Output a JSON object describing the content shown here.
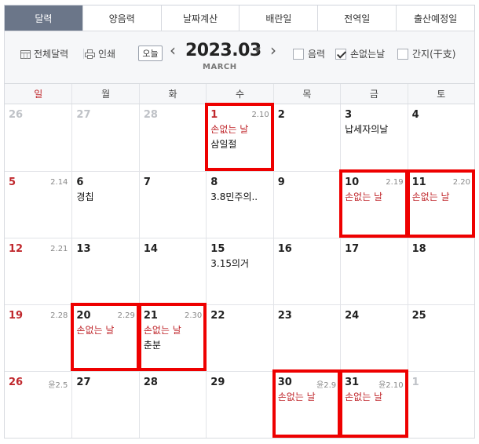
{
  "tabs": [
    {
      "label": "달력",
      "active": true
    },
    {
      "label": "양음력",
      "active": false
    },
    {
      "label": "날짜계산",
      "active": false
    },
    {
      "label": "배란일",
      "active": false
    },
    {
      "label": "전역일",
      "active": false
    },
    {
      "label": "출산예정일",
      "active": false
    }
  ],
  "toolbar": {
    "full_calendar": "전체달력",
    "print": "인쇄",
    "today": "오늘",
    "prev": "‹",
    "next": "›",
    "month": "2023.03",
    "caret": "▼",
    "month_en": "MARCH",
    "lunar_label": "음력",
    "lunar_checked": false,
    "sonless_label": "손없는날",
    "sonless_checked": true,
    "ganji_label": "간지(干支)",
    "ganji_checked": false
  },
  "weekdays": [
    "일",
    "월",
    "화",
    "수",
    "목",
    "금",
    "토"
  ],
  "colors": {
    "holiday_red": "#c0282d",
    "highlight": "#ee0000",
    "tab_active": "#6b7689"
  },
  "weeks": [
    [
      {
        "day": "26",
        "other": true
      },
      {
        "day": "27",
        "other": true
      },
      {
        "day": "28",
        "other": true
      },
      {
        "day": "1",
        "red_day": true,
        "lunar": "2.10",
        "events": [
          {
            "text": "손없는 날",
            "red": true
          },
          {
            "text": "삼일절",
            "red": false
          }
        ],
        "highlight": true
      },
      {
        "day": "2"
      },
      {
        "day": "3",
        "events": [
          {
            "text": "납세자의날",
            "red": false
          }
        ]
      },
      {
        "day": "4"
      }
    ],
    [
      {
        "day": "5",
        "lunar": "2.14"
      },
      {
        "day": "6",
        "events": [
          {
            "text": "경칩",
            "red": false
          }
        ]
      },
      {
        "day": "7"
      },
      {
        "day": "8",
        "events": [
          {
            "text": "3.8민주의..",
            "red": false
          }
        ]
      },
      {
        "day": "9"
      },
      {
        "day": "10",
        "lunar": "2.19",
        "events": [
          {
            "text": "손없는 날",
            "red": true
          }
        ],
        "highlight": true
      },
      {
        "day": "11",
        "lunar": "2.20",
        "events": [
          {
            "text": "손없는 날",
            "red": true
          }
        ],
        "highlight": true
      }
    ],
    [
      {
        "day": "12",
        "lunar": "2.21"
      },
      {
        "day": "13"
      },
      {
        "day": "14"
      },
      {
        "day": "15",
        "events": [
          {
            "text": "3.15의거",
            "red": false
          }
        ]
      },
      {
        "day": "16"
      },
      {
        "day": "17"
      },
      {
        "day": "18"
      }
    ],
    [
      {
        "day": "19",
        "lunar": "2.28"
      },
      {
        "day": "20",
        "lunar": "2.29",
        "events": [
          {
            "text": "손없는 날",
            "red": true
          }
        ],
        "highlight": true
      },
      {
        "day": "21",
        "lunar": "2.30",
        "events": [
          {
            "text": "손없는 날",
            "red": true
          },
          {
            "text": "춘분",
            "red": false
          }
        ],
        "highlight": true
      },
      {
        "day": "22"
      },
      {
        "day": "23"
      },
      {
        "day": "24"
      },
      {
        "day": "25"
      }
    ],
    [
      {
        "day": "26",
        "lunar": "윤2.5"
      },
      {
        "day": "27"
      },
      {
        "day": "28"
      },
      {
        "day": "29"
      },
      {
        "day": "30",
        "lunar": "윤2.9",
        "events": [
          {
            "text": "손없는 날",
            "red": true
          }
        ],
        "highlight": true
      },
      {
        "day": "31",
        "lunar": "윤2.10",
        "events": [
          {
            "text": "손없는 날",
            "red": true
          }
        ],
        "highlight": true
      },
      {
        "day": "1",
        "other": true
      }
    ]
  ]
}
